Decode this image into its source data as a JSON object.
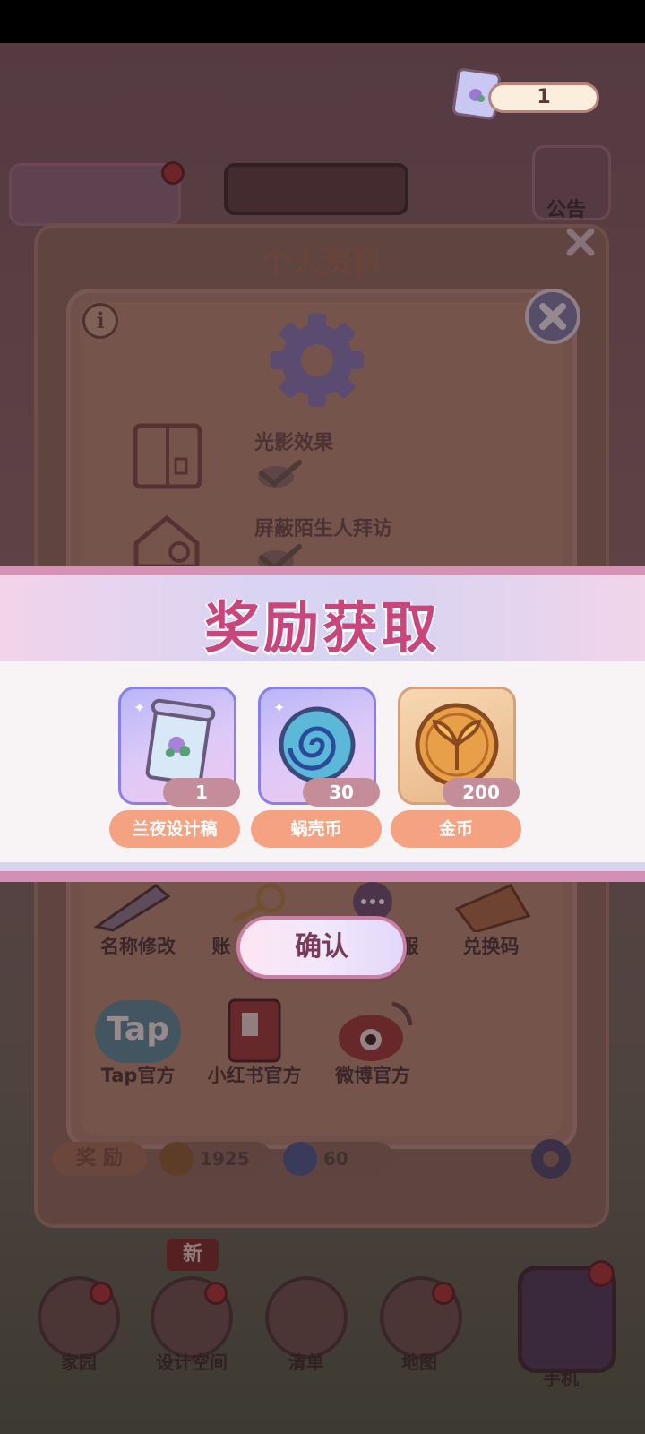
{
  "top_counter": {
    "value": "1"
  },
  "notice": {
    "label": "公告"
  },
  "profile": {
    "title": "个人资料"
  },
  "settings": {
    "items": [
      {
        "label": "光影效果"
      },
      {
        "label": "屏蔽陌生人拜访"
      }
    ]
  },
  "menu": {
    "row1": [
      "名称修改",
      "账",
      "服",
      "兑换码"
    ],
    "row2": [
      "Tap官方",
      "小红书官方",
      "微博官方"
    ],
    "tap_logo": "Tap"
  },
  "reward_bar": {
    "label": "奖 励",
    "coins": "1925",
    "shells": "60"
  },
  "reward_modal": {
    "title": "奖励获取",
    "items": [
      {
        "name": "兰夜设计稿",
        "count": "1",
        "icon": "design-scroll-icon"
      },
      {
        "name": "蜗壳币",
        "count": "30",
        "icon": "snail-shell-coin-icon"
      },
      {
        "name": "金币",
        "count": "200",
        "icon": "gold-coin-icon"
      }
    ],
    "confirm_label": "确认"
  },
  "nav": {
    "new_badge": "新",
    "items": [
      {
        "label": "家园",
        "icon": "home-icon"
      },
      {
        "label": "设计空间",
        "icon": "design-icon"
      },
      {
        "label": "清单",
        "icon": "list-icon"
      },
      {
        "label": "地图",
        "icon": "map-icon"
      },
      {
        "label": "手机",
        "icon": "phone-icon"
      }
    ]
  },
  "colors": {
    "modal_title": "#c9467c",
    "name_pill": "#f4a282",
    "count_pill": "#c58c9a",
    "confirm_border": "#cc7fa6"
  }
}
